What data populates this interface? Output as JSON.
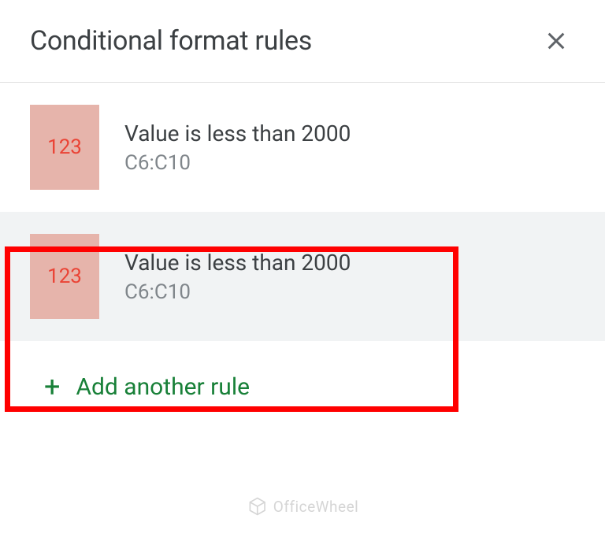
{
  "header": {
    "title": "Conditional format rules"
  },
  "rules": [
    {
      "preview_text": "123",
      "condition": "Value is less than 2000",
      "range": "C6:C10",
      "selected": false
    },
    {
      "preview_text": "123",
      "condition": "Value is less than 2000",
      "range": "C6:C10",
      "selected": true
    }
  ],
  "add_rule_label": "Add another rule",
  "watermark": "OfficeWheel"
}
